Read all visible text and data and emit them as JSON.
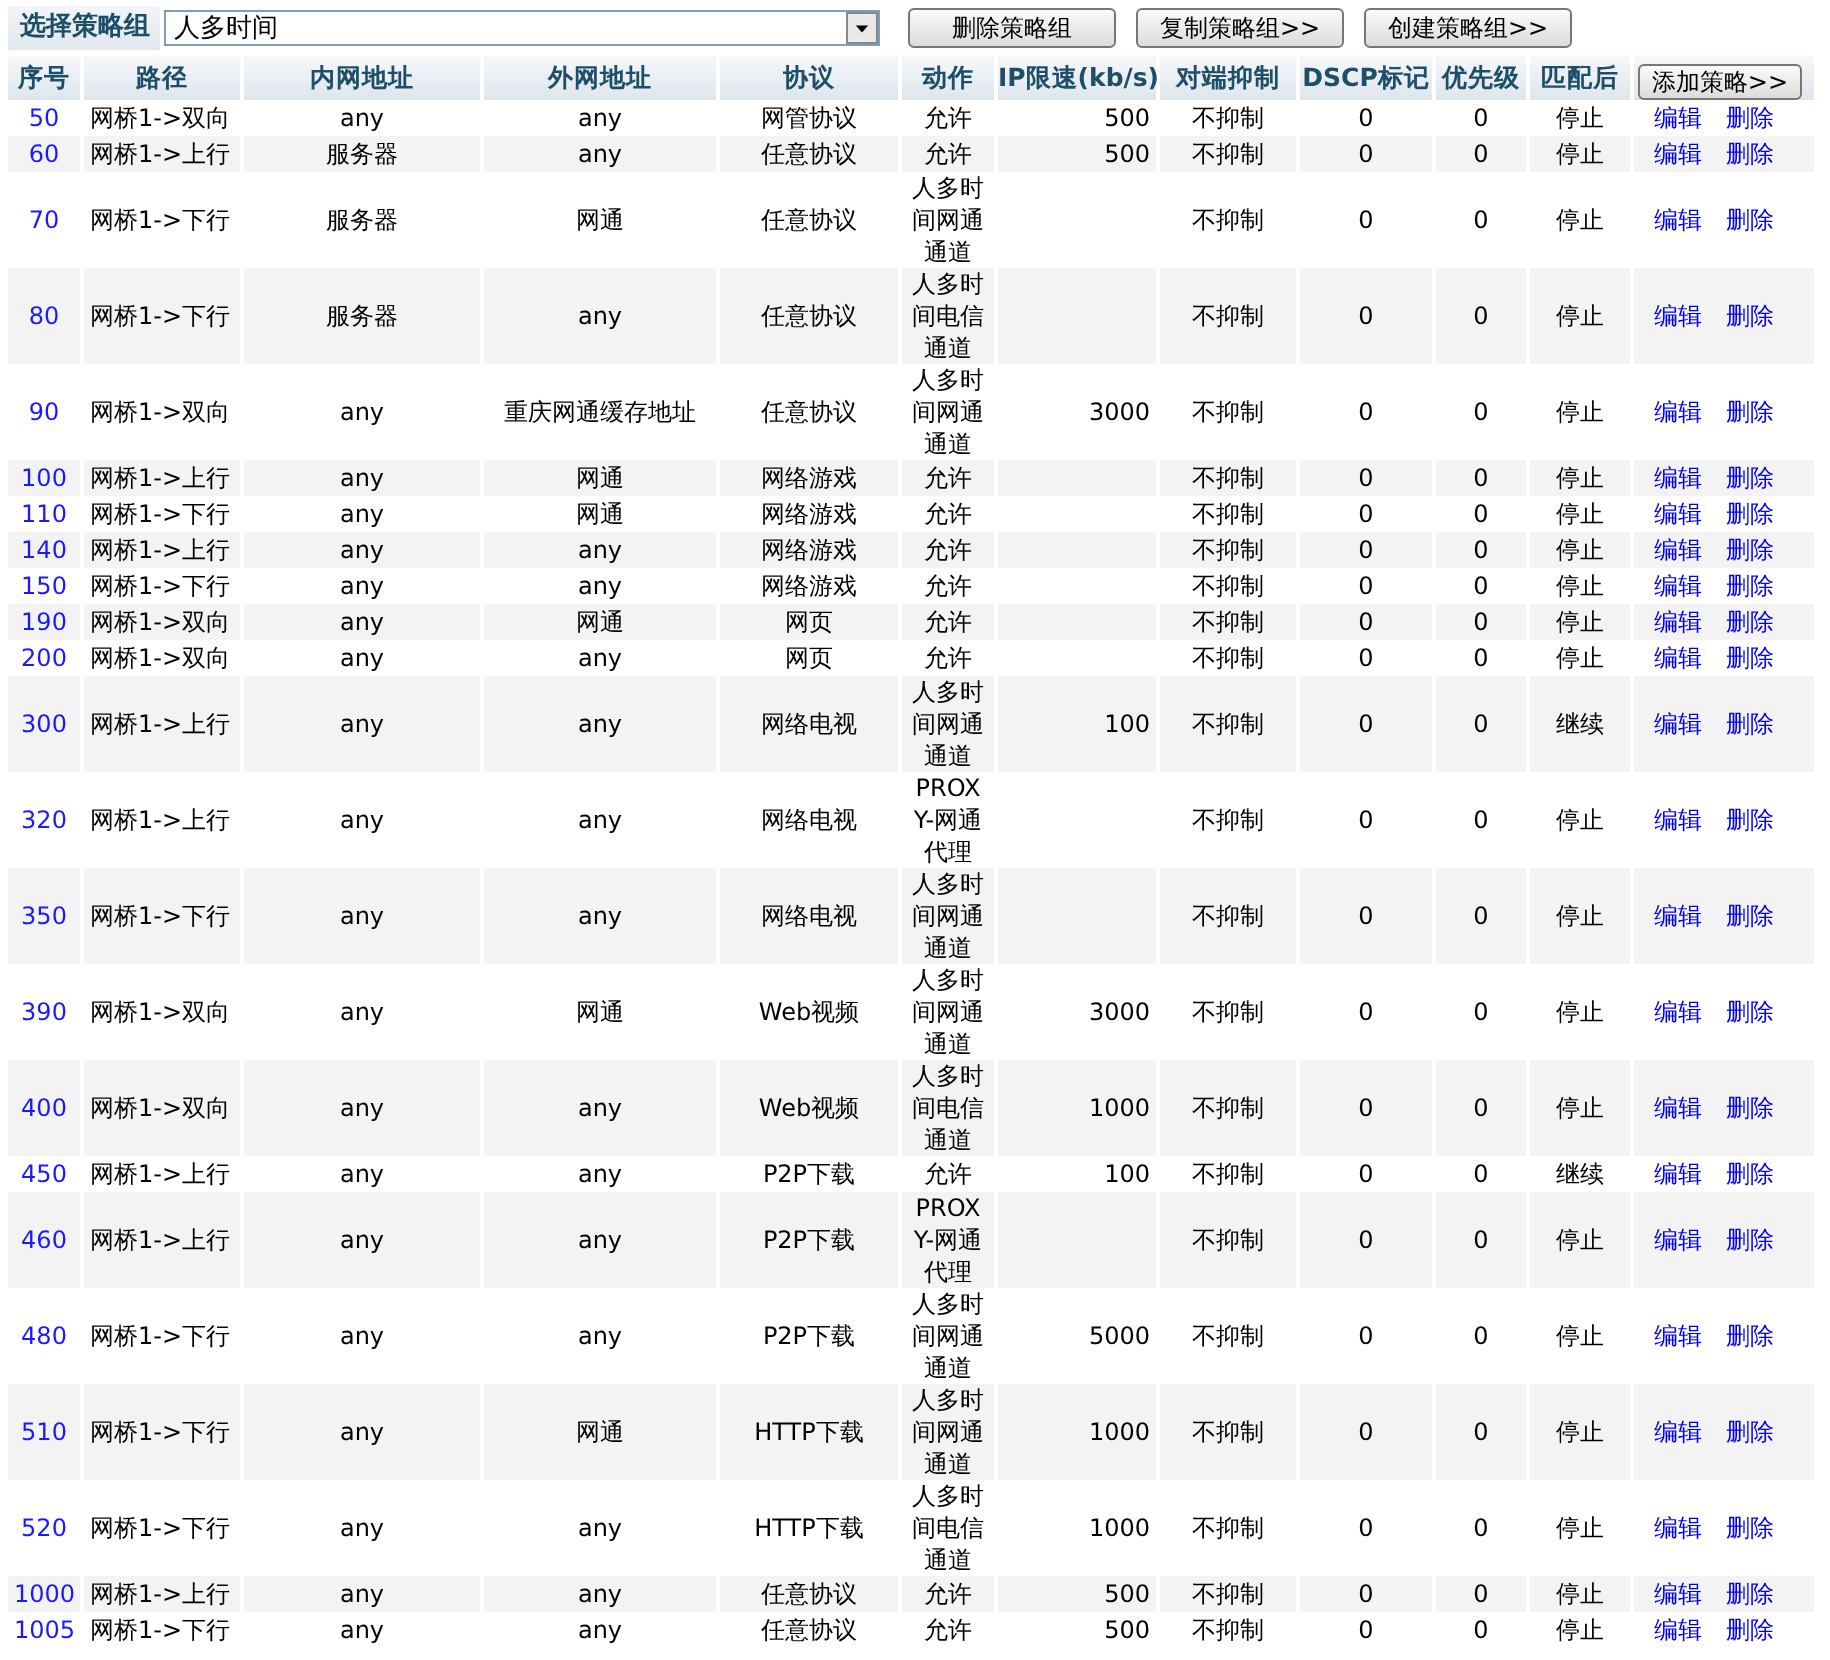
{
  "toolbar": {
    "label": "选择策略组",
    "group_select": {
      "value": "人多时间"
    },
    "buttons": [
      "删除策略组",
      "复制策略组>>",
      "创建策略组>>"
    ]
  },
  "table": {
    "columns": [
      "序号",
      "路径",
      "内网地址",
      "外网地址",
      "协议",
      "动作",
      "IP限速(kb/s)",
      "对端抑制",
      "DSCP标记",
      "优先级",
      "匹配后"
    ],
    "add_button": "添加策略>>",
    "rows": [
      {
        "id": "50",
        "path": "网桥1->双向",
        "lan": "any",
        "wan": "any",
        "protocol": "网管协议",
        "action": "允许",
        "rate": "500",
        "peer": "不抑制",
        "dscp": "0",
        "priority": "0",
        "after": "停止",
        "edit": "编辑",
        "delete": "删除"
      },
      {
        "id": "60",
        "path": "网桥1->上行",
        "lan": "服务器",
        "wan": "any",
        "protocol": "任意协议",
        "action": "允许",
        "rate": "500",
        "peer": "不抑制",
        "dscp": "0",
        "priority": "0",
        "after": "停止",
        "edit": "编辑",
        "delete": "删除"
      },
      {
        "id": "70",
        "path": "网桥1->下行",
        "lan": "服务器",
        "wan": "网通",
        "protocol": "任意协议",
        "action": "人多时间网通通道",
        "peer": "不抑制",
        "dscp": "0",
        "priority": "0",
        "after": "停止",
        "edit": "编辑",
        "delete": "删除"
      },
      {
        "id": "80",
        "path": "网桥1->下行",
        "lan": "服务器",
        "wan": "any",
        "protocol": "任意协议",
        "action": "人多时间电信通道",
        "peer": "不抑制",
        "dscp": "0",
        "priority": "0",
        "after": "停止",
        "edit": "编辑",
        "delete": "删除"
      },
      {
        "id": "90",
        "path": "网桥1->双向",
        "lan": "any",
        "wan": "重庆网通缓存地址",
        "protocol": "任意协议",
        "action": "人多时间网通通道",
        "rate": "3000",
        "peer": "不抑制",
        "dscp": "0",
        "priority": "0",
        "after": "停止",
        "edit": "编辑",
        "delete": "删除"
      },
      {
        "id": "100",
        "path": "网桥1->上行",
        "lan": "any",
        "wan": "网通",
        "protocol": "网络游戏",
        "action": "允许",
        "peer": "不抑制",
        "dscp": "0",
        "priority": "0",
        "after": "停止",
        "edit": "编辑",
        "delete": "删除"
      },
      {
        "id": "110",
        "path": "网桥1->下行",
        "lan": "any",
        "wan": "网通",
        "protocol": "网络游戏",
        "action": "允许",
        "peer": "不抑制",
        "dscp": "0",
        "priority": "0",
        "after": "停止",
        "edit": "编辑",
        "delete": "删除"
      },
      {
        "id": "140",
        "path": "网桥1->上行",
        "lan": "any",
        "wan": "any",
        "protocol": "网络游戏",
        "action": "允许",
        "peer": "不抑制",
        "dscp": "0",
        "priority": "0",
        "after": "停止",
        "edit": "编辑",
        "delete": "删除"
      },
      {
        "id": "150",
        "path": "网桥1->下行",
        "lan": "any",
        "wan": "any",
        "protocol": "网络游戏",
        "action": "允许",
        "peer": "不抑制",
        "dscp": "0",
        "priority": "0",
        "after": "停止",
        "edit": "编辑",
        "delete": "删除"
      },
      {
        "id": "190",
        "path": "网桥1->双向",
        "lan": "any",
        "wan": "网通",
        "protocol": "网页",
        "action": "允许",
        "peer": "不抑制",
        "dscp": "0",
        "priority": "0",
        "after": "停止",
        "edit": "编辑",
        "delete": "删除"
      },
      {
        "id": "200",
        "path": "网桥1->双向",
        "lan": "any",
        "wan": "any",
        "protocol": "网页",
        "action": "允许",
        "peer": "不抑制",
        "dscp": "0",
        "priority": "0",
        "after": "停止",
        "edit": "编辑",
        "delete": "删除"
      },
      {
        "id": "300",
        "path": "网桥1->上行",
        "lan": "any",
        "wan": "any",
        "protocol": "网络电视",
        "action": "人多时间网通通道",
        "rate": "100",
        "peer": "不抑制",
        "dscp": "0",
        "priority": "0",
        "after": "继续",
        "edit": "编辑",
        "delete": "删除"
      },
      {
        "id": "320",
        "path": "网桥1->上行",
        "lan": "any",
        "wan": "any",
        "protocol": "网络电视",
        "action": "PROXY-网通代理",
        "peer": "不抑制",
        "dscp": "0",
        "priority": "0",
        "after": "停止",
        "edit": "编辑",
        "delete": "删除"
      },
      {
        "id": "350",
        "path": "网桥1->下行",
        "lan": "any",
        "wan": "any",
        "protocol": "网络电视",
        "action": "人多时间网通通道",
        "peer": "不抑制",
        "dscp": "0",
        "priority": "0",
        "after": "停止",
        "edit": "编辑",
        "delete": "删除"
      },
      {
        "id": "390",
        "path": "网桥1->双向",
        "lan": "any",
        "wan": "网通",
        "protocol": "Web视频",
        "action": "人多时间网通通道",
        "rate": "3000",
        "peer": "不抑制",
        "dscp": "0",
        "priority": "0",
        "after": "停止",
        "edit": "编辑",
        "delete": "删除"
      },
      {
        "id": "400",
        "path": "网桥1->双向",
        "lan": "any",
        "wan": "any",
        "protocol": "Web视频",
        "action": "人多时间电信通道",
        "rate": "1000",
        "peer": "不抑制",
        "dscp": "0",
        "priority": "0",
        "after": "停止",
        "edit": "编辑",
        "delete": "删除"
      },
      {
        "id": "450",
        "path": "网桥1->上行",
        "lan": "any",
        "wan": "any",
        "protocol": "P2P下载",
        "action": "允许",
        "rate": "100",
        "peer": "不抑制",
        "dscp": "0",
        "priority": "0",
        "after": "继续",
        "edit": "编辑",
        "delete": "删除"
      },
      {
        "id": "460",
        "path": "网桥1->上行",
        "lan": "any",
        "wan": "any",
        "protocol": "P2P下载",
        "action": "PROXY-网通代理",
        "peer": "不抑制",
        "dscp": "0",
        "priority": "0",
        "after": "停止",
        "edit": "编辑",
        "delete": "删除"
      },
      {
        "id": "480",
        "path": "网桥1->下行",
        "lan": "any",
        "wan": "any",
        "protocol": "P2P下载",
        "action": "人多时间网通通道",
        "rate": "5000",
        "peer": "不抑制",
        "dscp": "0",
        "priority": "0",
        "after": "停止",
        "edit": "编辑",
        "delete": "删除"
      },
      {
        "id": "510",
        "path": "网桥1->下行",
        "lan": "any",
        "wan": "网通",
        "protocol": "HTTP下载",
        "action": "人多时间网通通道",
        "rate": "1000",
        "peer": "不抑制",
        "dscp": "0",
        "priority": "0",
        "after": "停止",
        "edit": "编辑",
        "delete": "删除"
      },
      {
        "id": "520",
        "path": "网桥1->下行",
        "lan": "any",
        "wan": "any",
        "protocol": "HTTP下载",
        "action": "人多时间电信通道",
        "rate": "1000",
        "peer": "不抑制",
        "dscp": "0",
        "priority": "0",
        "after": "停止",
        "edit": "编辑",
        "delete": "删除"
      },
      {
        "id": "1000",
        "path": "网桥1->上行",
        "lan": "any",
        "wan": "any",
        "protocol": "任意协议",
        "action": "允许",
        "rate": "500",
        "peer": "不抑制",
        "dscp": "0",
        "priority": "0",
        "after": "停止",
        "edit": "编辑",
        "delete": "删除"
      },
      {
        "id": "1005",
        "path": "网桥1->下行",
        "lan": "any",
        "wan": "any",
        "protocol": "任意协议",
        "action": "允许",
        "rate": "500",
        "peer": "不抑制",
        "dscp": "0",
        "priority": "0",
        "after": "停止",
        "edit": "编辑",
        "delete": "删除"
      }
    ]
  }
}
